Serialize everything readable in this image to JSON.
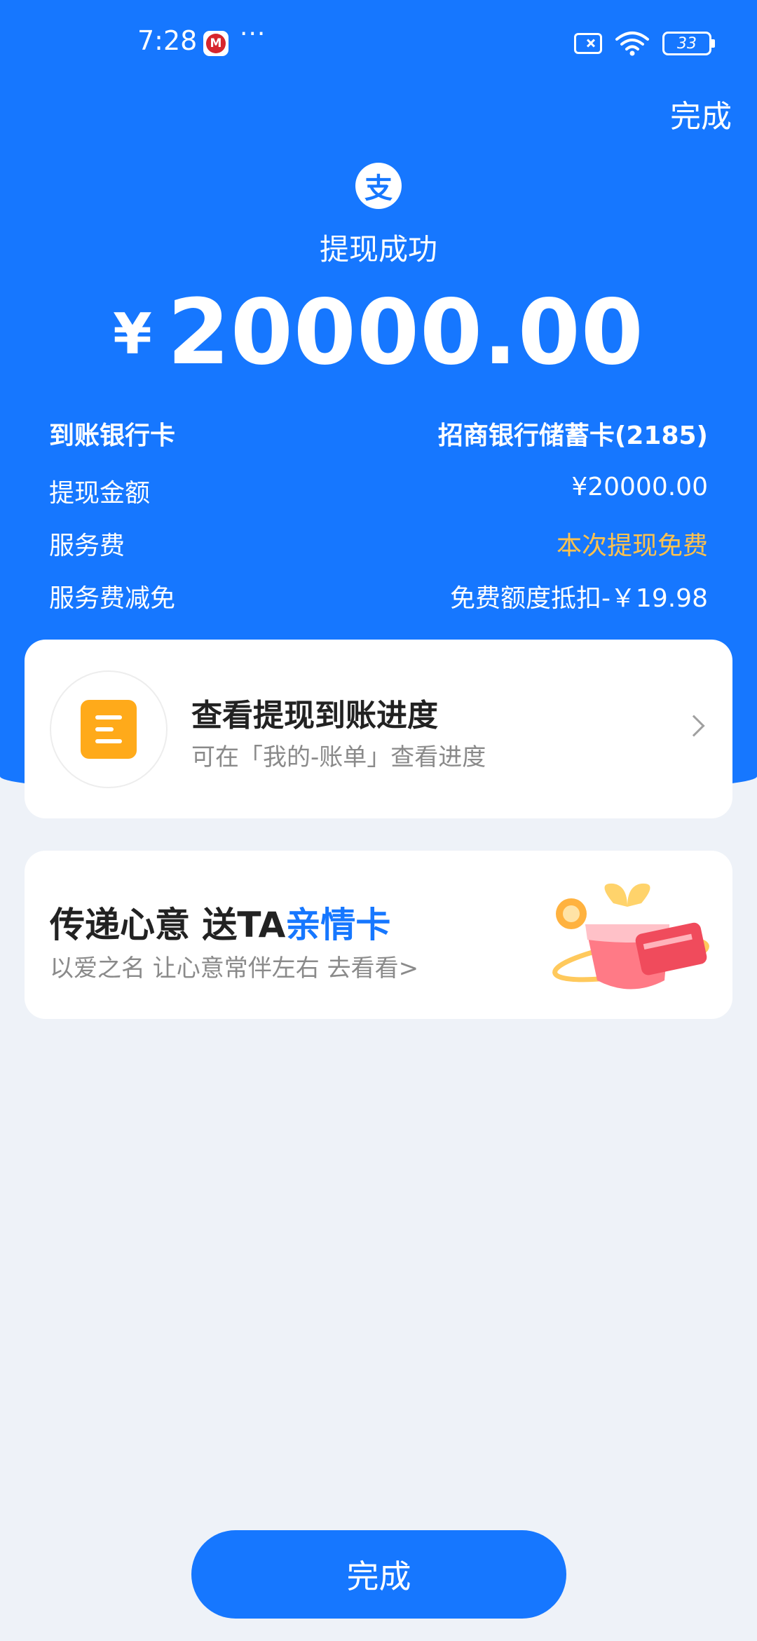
{
  "status_bar": {
    "time": "7:28",
    "app_icon": "cmb-bank-icon",
    "more": "···",
    "battery": "33"
  },
  "header": {
    "done_label": "完成",
    "logo_char": "支",
    "title": "提现成功",
    "currency": "¥",
    "amount": "20000.00"
  },
  "details": [
    {
      "label": "到账银行卡",
      "value": "招商银行储蓄卡(2185)"
    },
    {
      "label": "提现金额",
      "value": "¥20000.00"
    },
    {
      "label": "服务费",
      "value": "本次提现免费",
      "value_color": "#FFC24D"
    },
    {
      "label": "服务费减免",
      "value": "免费额度抵扣-￥19.98"
    }
  ],
  "progress_card": {
    "title": "查看提现到账进度",
    "subtitle": "可在「我的-账单」查看进度"
  },
  "promo_card": {
    "title_prefix": "传递心意 送TA",
    "title_highlight": "亲情卡",
    "subtitle": "以爱之名 让心意常伴左右 去看看>"
  },
  "bottom_button": {
    "label": "完成"
  },
  "colors": {
    "primary": "#1677FF",
    "accent_orange": "#FFC24D",
    "background": "#EEF2F8"
  }
}
